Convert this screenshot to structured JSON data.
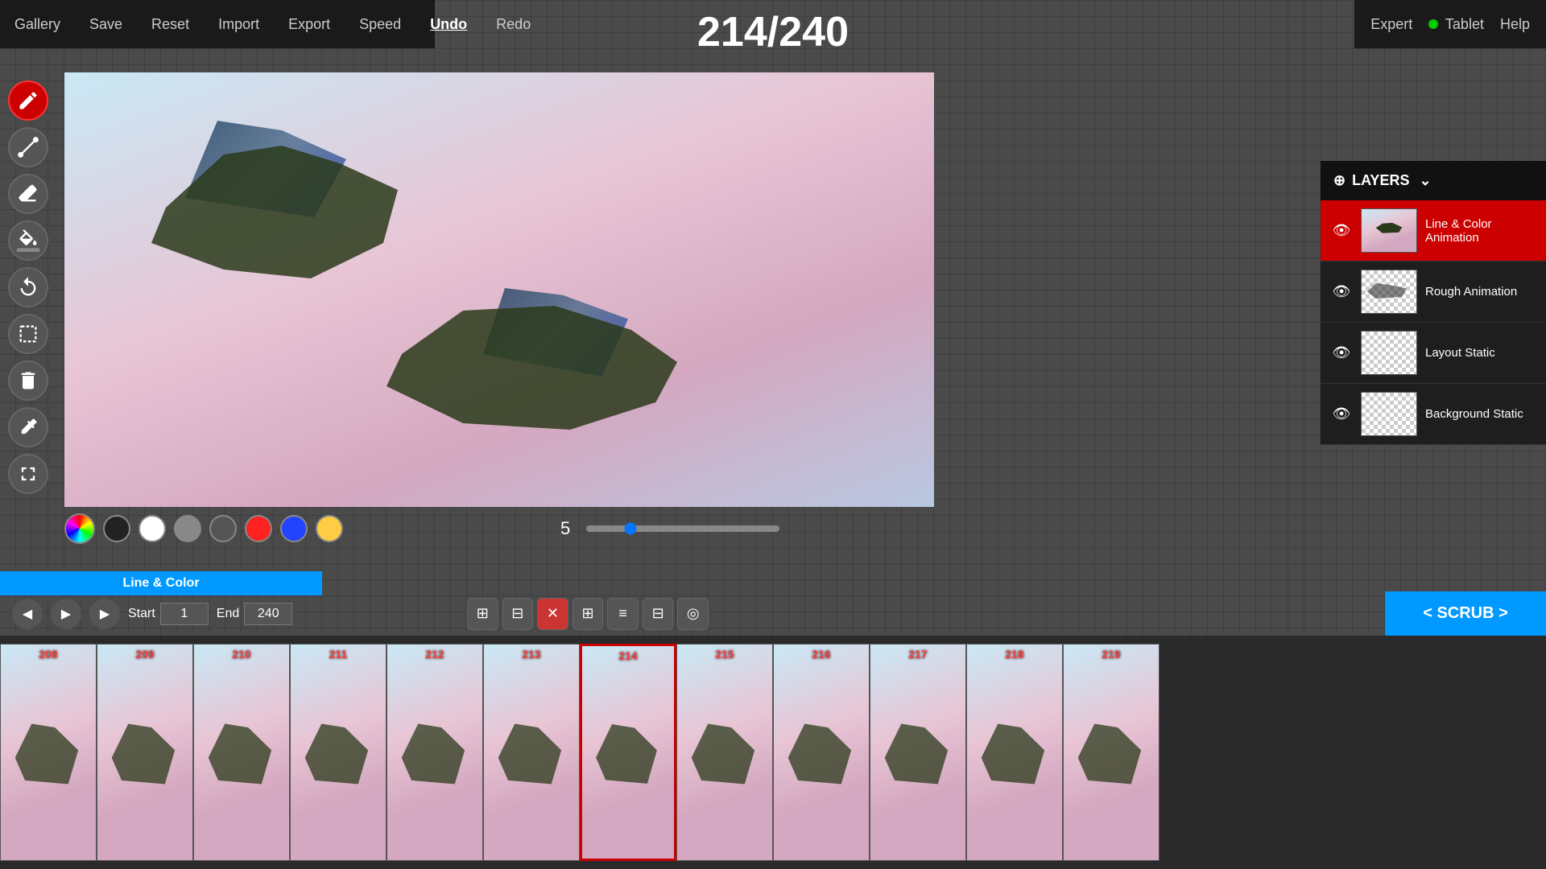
{
  "topMenu": {
    "items": [
      {
        "label": "Gallery",
        "active": false
      },
      {
        "label": "Save",
        "active": false
      },
      {
        "label": "Reset",
        "active": false
      },
      {
        "label": "Import",
        "active": false
      },
      {
        "label": "Export",
        "active": false
      },
      {
        "label": "Speed",
        "active": false
      },
      {
        "label": "Undo",
        "active": true
      },
      {
        "label": "Redo",
        "active": false
      }
    ]
  },
  "topRight": {
    "expert": "Expert",
    "tablet": "Tablet",
    "help": "Help"
  },
  "frameCounter": "214/240",
  "layers": {
    "title": "LAYERS",
    "items": [
      {
        "name": "Line & Color Animation",
        "active": true,
        "type": "animation"
      },
      {
        "name": "Rough Animation",
        "active": false,
        "type": "rough"
      },
      {
        "name": "Layout Static",
        "active": false,
        "type": "transparent"
      },
      {
        "name": "Background Static",
        "active": false,
        "type": "transparent"
      }
    ]
  },
  "colors": {
    "swatches": [
      {
        "color": "#222222",
        "label": "black"
      },
      {
        "color": "#ffffff",
        "label": "white"
      },
      {
        "color": "#888888",
        "label": "gray"
      },
      {
        "color": "#555555",
        "label": "dark-gray"
      },
      {
        "color": "#ff2222",
        "label": "red"
      },
      {
        "color": "#2244ff",
        "label": "blue"
      },
      {
        "color": "#ffcc44",
        "label": "yellow"
      }
    ]
  },
  "brushSize": "5",
  "timeline": {
    "startLabel": "Start",
    "startValue": "1",
    "endLabel": "End",
    "endValue": "240",
    "layerLabel": "Line & Color",
    "scrubLabel": "< SCRUB >",
    "frames": [
      208,
      209,
      210,
      211,
      212,
      213,
      214,
      215,
      216,
      217,
      218,
      219
    ],
    "currentFrame": 214
  },
  "tools": [
    {
      "icon": "✏️",
      "name": "pencil",
      "active": true
    },
    {
      "icon": "⊘",
      "name": "eraser",
      "active": false
    },
    {
      "icon": "◈",
      "name": "fill",
      "active": false
    },
    {
      "icon": "⬡",
      "name": "eyedropper",
      "active": false
    },
    {
      "icon": "↺",
      "name": "undo-tool",
      "active": false
    },
    {
      "icon": "⊡",
      "name": "select",
      "active": false
    },
    {
      "icon": "🗑",
      "name": "delete",
      "active": false
    },
    {
      "icon": "🔧",
      "name": "settings",
      "active": false
    },
    {
      "icon": "⤢",
      "name": "fullscreen",
      "active": false
    }
  ],
  "timelineButtons": [
    {
      "icon": "⊞",
      "name": "add-frame"
    },
    {
      "icon": "⊟",
      "name": "copy-frame"
    },
    {
      "icon": "✕",
      "name": "delete-frame"
    },
    {
      "icon": "⊞",
      "name": "add-layer"
    },
    {
      "icon": "≡",
      "name": "layer-options"
    },
    {
      "icon": "⊟",
      "name": "remove-layer"
    },
    {
      "icon": "◎",
      "name": "onion-skin"
    }
  ]
}
